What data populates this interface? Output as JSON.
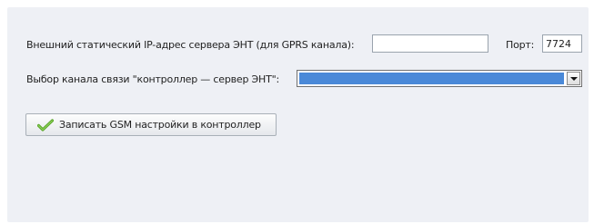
{
  "form": {
    "ip_label": "Внешний статический IP-адрес сервера ЭНТ (для GPRS канала):",
    "ip_value": "",
    "port_label": "Порт:",
    "port_value": "7724",
    "channel_label": "Выбор канала связи \"контроллер — сервер ЭНТ\":",
    "channel_selected": "",
    "save_button_label": "Записать GSM настройки в контроллер",
    "save_button_icon": "checkmark-icon"
  },
  "colors": {
    "panel_background": "#eef0f5",
    "select_highlight": "#4a89d8",
    "checkmark": "#5aa52a"
  }
}
